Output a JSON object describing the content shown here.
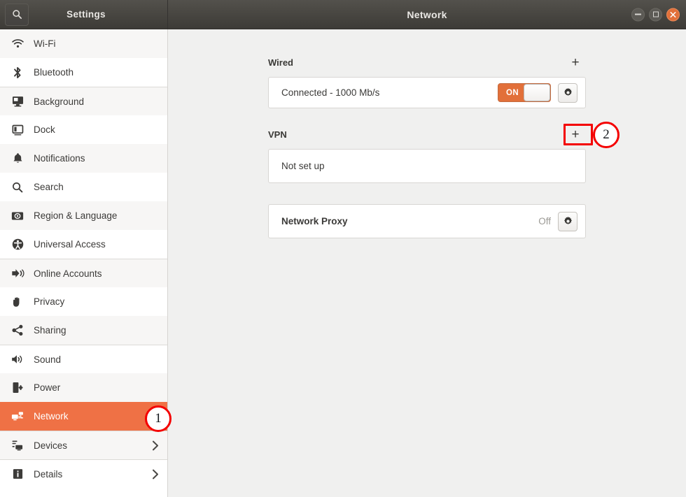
{
  "window": {
    "settings_title": "Settings",
    "page_title": "Network",
    "search_icon": "search-icon",
    "controls": {
      "minimize": "minimize-icon",
      "maximize": "maximize-icon",
      "close": "close-icon"
    }
  },
  "sidebar": {
    "items": [
      {
        "label": "Wi-Fi",
        "icon": "wifi-icon",
        "chevron": false,
        "selected": false
      },
      {
        "label": "Bluetooth",
        "icon": "bluetooth-icon",
        "chevron": false,
        "selected": false
      },
      {
        "label": "Background",
        "icon": "background-icon",
        "chevron": false,
        "selected": false
      },
      {
        "label": "Dock",
        "icon": "dock-icon",
        "chevron": false,
        "selected": false
      },
      {
        "label": "Notifications",
        "icon": "bell-icon",
        "chevron": false,
        "selected": false
      },
      {
        "label": "Search",
        "icon": "search-icon",
        "chevron": false,
        "selected": false
      },
      {
        "label": "Region & Language",
        "icon": "region-language-icon",
        "chevron": false,
        "selected": false
      },
      {
        "label": "Universal Access",
        "icon": "universal-access-icon",
        "chevron": false,
        "selected": false
      },
      {
        "label": "Online Accounts",
        "icon": "online-accounts-icon",
        "chevron": false,
        "selected": false
      },
      {
        "label": "Privacy",
        "icon": "privacy-hand-icon",
        "chevron": false,
        "selected": false
      },
      {
        "label": "Sharing",
        "icon": "sharing-icon",
        "chevron": false,
        "selected": false
      },
      {
        "label": "Sound",
        "icon": "sound-icon",
        "chevron": false,
        "selected": false
      },
      {
        "label": "Power",
        "icon": "power-icon",
        "chevron": false,
        "selected": false
      },
      {
        "label": "Network",
        "icon": "network-icon",
        "chevron": false,
        "selected": true
      },
      {
        "label": "Devices",
        "icon": "devices-icon",
        "chevron": true,
        "selected": false
      },
      {
        "label": "Details",
        "icon": "details-info-icon",
        "chevron": true,
        "selected": false
      }
    ]
  },
  "main": {
    "wired": {
      "title": "Wired",
      "add_label": "+",
      "status": "Connected - 1000 Mb/s",
      "toggle_state": "ON",
      "gear_icon": "gear-icon"
    },
    "vpn": {
      "title": "VPN",
      "add_label": "+",
      "status": "Not set up"
    },
    "proxy": {
      "title": "Network Proxy",
      "status": "Off",
      "gear_icon": "gear-icon"
    }
  },
  "annotations": {
    "accent_color": "#f40000",
    "markers": [
      {
        "number": "1",
        "target": "sidebar-item-network"
      },
      {
        "number": "2",
        "target": "vpn-add-button"
      }
    ]
  },
  "colors": {
    "accent_orange": "#ef7145",
    "toggle_on": "#e2703a",
    "titlebar_dark": "#474540",
    "annotation_red": "#f40000"
  }
}
